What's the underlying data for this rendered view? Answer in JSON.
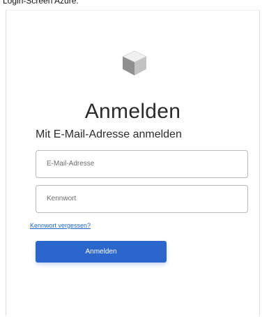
{
  "caption": "Login-Screen Azure:",
  "login": {
    "heading": "Anmelden",
    "subheading": "Mit E-Mail-Adresse anmelden",
    "email_placeholder": "E-Mail-Adresse",
    "password_placeholder": "Kennwort",
    "forgot_link": "Kennwort vergessen?",
    "submit_label": "Anmelden",
    "logo_icon": "cube-icon"
  },
  "colors": {
    "accent": "#2b66cc",
    "link": "#1b64c8",
    "border": "#b9b9b9"
  }
}
